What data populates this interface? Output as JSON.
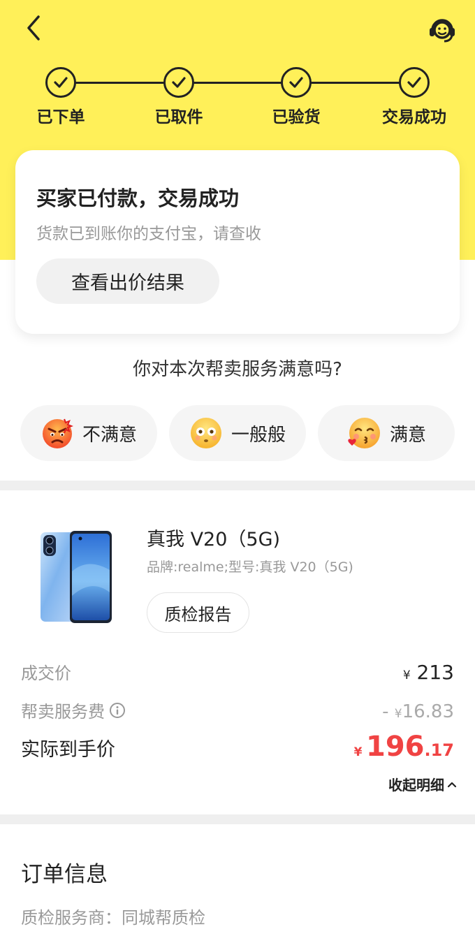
{
  "header": {
    "back_icon": "chevron-left-icon",
    "service_icon": "customer-service-icon"
  },
  "progress": {
    "steps": [
      {
        "label": "已下单",
        "icon": "check-icon"
      },
      {
        "label": "已取件",
        "icon": "check-icon"
      },
      {
        "label": "已验货",
        "icon": "check-icon"
      },
      {
        "label": "交易成功",
        "icon": "check-icon"
      }
    ]
  },
  "status": {
    "title": "买家已付款，交易成功",
    "subtitle": "货款已到账你的支付宝，请查收",
    "result_button": "查看出价结果"
  },
  "survey": {
    "question": "你对本次帮卖服务满意吗?",
    "options": [
      {
        "label": "不满意",
        "icon": "angry-face-icon"
      },
      {
        "label": "一般般",
        "icon": "neutral-face-icon"
      },
      {
        "label": "满意",
        "icon": "kissing-face-icon"
      }
    ]
  },
  "product": {
    "name": "真我 V20（5G)",
    "spec": "品牌:realme;型号:真我 V20（5G)",
    "qc_button": "质检报告",
    "image": "phone-image"
  },
  "pricing": {
    "deal_label": "成交价",
    "deal_currency": "¥",
    "deal_value": "213",
    "fee_label": "帮卖服务费",
    "fee_sign": "-",
    "fee_currency": "¥",
    "fee_value": "16.83",
    "net_label": "实际到手价",
    "net_currency": "¥",
    "net_integer": "196",
    "net_decimal": ".17",
    "collapse_label": "收起明细"
  },
  "order": {
    "title": "订单信息",
    "qc_provider": "质检服务商：同城帮质检"
  },
  "colors": {
    "brand_yellow": "#fff059",
    "price_red": "#f04343"
  }
}
